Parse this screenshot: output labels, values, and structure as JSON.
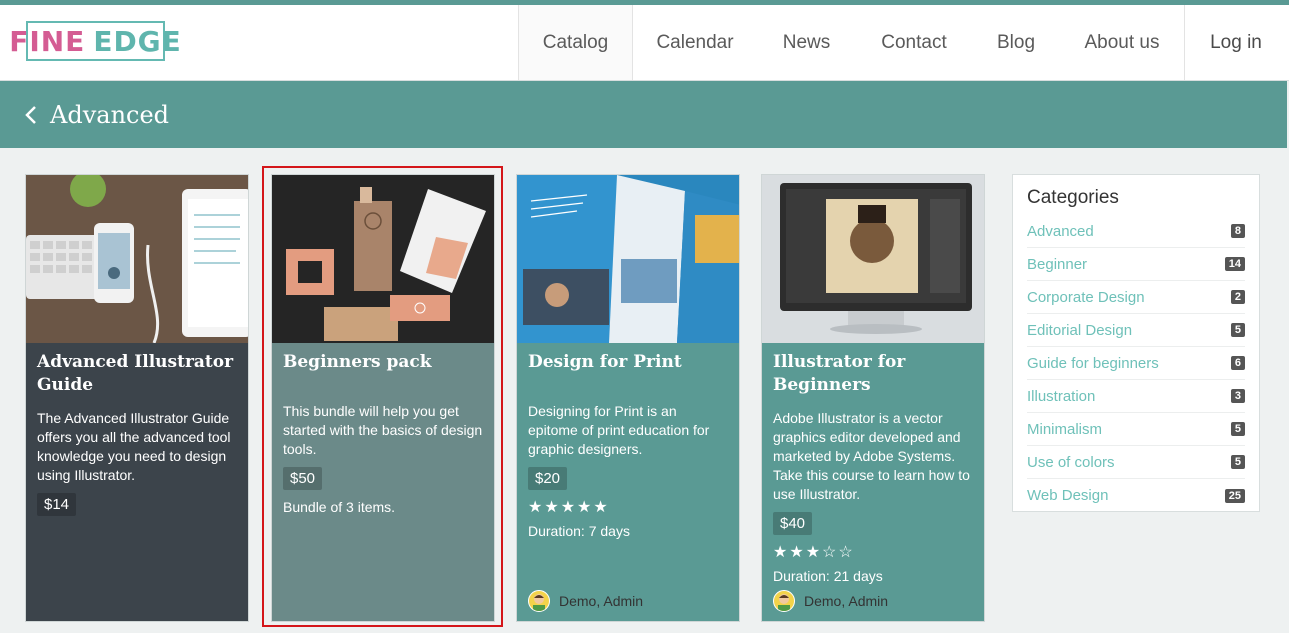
{
  "header": {
    "logo": {
      "word1": "FINE",
      "word2": "EDGE"
    },
    "nav": [
      {
        "label": "Catalog",
        "width": 115
      },
      {
        "label": "Calendar",
        "width": 124
      },
      {
        "label": "News",
        "width": 99
      },
      {
        "label": "Contact",
        "width": 116
      },
      {
        "label": "Blog",
        "width": 88
      },
      {
        "label": "About us",
        "width": 126
      }
    ],
    "login": "Log in"
  },
  "title": {
    "text": "Advanced"
  },
  "cards": [
    {
      "title": "Advanced Illustrator Guide",
      "description": "The Advanced Illustrator Guide offers you all the advanced tool knowledge you need to design using Illustrator.",
      "price": "$14"
    },
    {
      "title": "Beginners pack",
      "description": "This bundle will help you get started with the basics of design tools.",
      "price": "$50",
      "note": "Bundle of 3 items."
    },
    {
      "title": "Design for Print",
      "description": "Designing for Print is an epitome of print education for graphic designers.",
      "price": "$20",
      "stars": "★★★★★",
      "duration": "Duration: 7 days",
      "author": "Demo, Admin"
    },
    {
      "title": "Illustrator for Beginners",
      "description": "Adobe Illustrator is a vector graphics editor developed and marketed by Adobe Systems. Take this course to learn how to use Illustrator.",
      "price": "$40",
      "stars": "★★★☆☆",
      "duration": "Duration: 21 days",
      "author": "Demo, Admin"
    }
  ],
  "sidebar": {
    "heading": "Categories",
    "items": [
      {
        "label": "Advanced",
        "count": "8"
      },
      {
        "label": "Beginner",
        "count": "14"
      },
      {
        "label": "Corporate Design",
        "count": "2"
      },
      {
        "label": "Editorial Design",
        "count": "5"
      },
      {
        "label": "Guide for beginners",
        "count": "6"
      },
      {
        "label": "Illustration",
        "count": "3"
      },
      {
        "label": "Minimalism",
        "count": "5"
      },
      {
        "label": "Use of colors",
        "count": "5"
      },
      {
        "label": "Web Design",
        "count": "25"
      }
    ]
  },
  "colors": {
    "accent": "#5a9a94",
    "logo_pink": "#d45c93",
    "logo_teal": "#5fb5ad",
    "highlight": "#d4161a"
  }
}
